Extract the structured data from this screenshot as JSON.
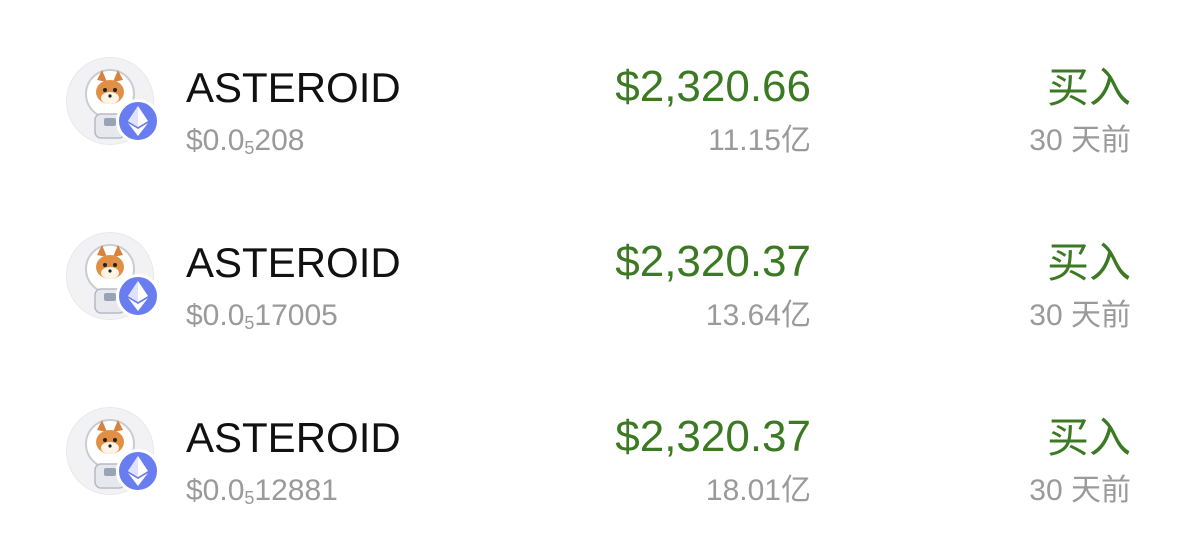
{
  "rows": [
    {
      "name": "ASTEROID",
      "price_prefix": "$0.0",
      "price_zeros": "5",
      "price_digits": "208",
      "amount": "$2,320.66",
      "volume": "11.15亿",
      "action_label": "买入",
      "time": "30 天前",
      "avatar_icon": "shiba-astronaut-icon",
      "chain_icon": "ethereum-icon"
    },
    {
      "name": "ASTEROID",
      "price_prefix": "$0.0",
      "price_zeros": "5",
      "price_digits": "17005",
      "amount": "$2,320.37",
      "volume": "13.64亿",
      "action_label": "买入",
      "time": "30 天前",
      "avatar_icon": "shiba-astronaut-icon",
      "chain_icon": "ethereum-icon"
    },
    {
      "name": "ASTEROID",
      "price_prefix": "$0.0",
      "price_zeros": "5",
      "price_digits": "12881",
      "amount": "$2,320.37",
      "volume": "18.01亿",
      "action_label": "买入",
      "time": "30 天前",
      "avatar_icon": "shiba-astronaut-icon",
      "chain_icon": "ethereum-icon"
    }
  ],
  "colors": {
    "buy_green": "#3b7a23",
    "muted_gray": "#9a9a9a",
    "eth_badge": "#6a7df0"
  }
}
